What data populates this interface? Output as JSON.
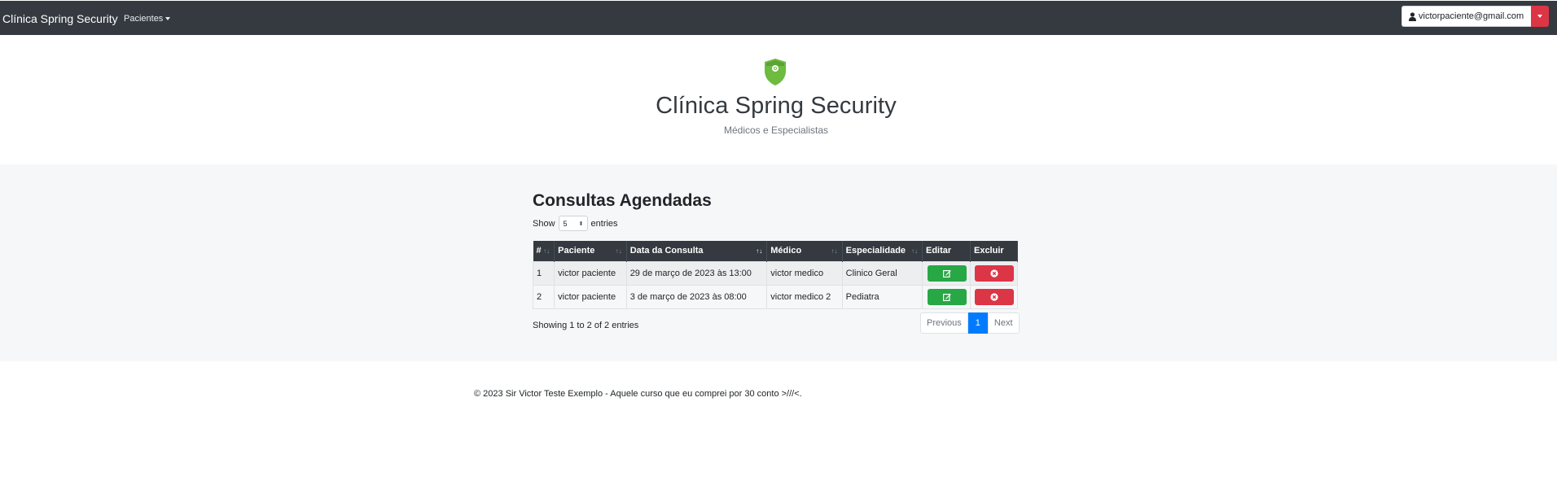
{
  "navbar": {
    "brand": "Clínica Spring Security",
    "menu_label": "Pacientes",
    "user_email": "victorpaciente@gmail.com"
  },
  "header": {
    "title": "Clínica Spring Security",
    "subtitle": "Médicos e Especialistas"
  },
  "main": {
    "section_title": "Consultas Agendadas",
    "show_label": "Show",
    "show_value": "5",
    "entries_label": "entries",
    "table": {
      "columns": [
        "#",
        "Paciente",
        "Data da Consulta",
        "Médico",
        "Especialidade",
        "Editar",
        "Excluir"
      ],
      "rows": [
        {
          "id": "1",
          "paciente": "victor paciente",
          "data": "29 de março de 2023 às 13:00",
          "medico": "victor medico",
          "especialidade": "Clinico Geral"
        },
        {
          "id": "2",
          "paciente": "victor paciente",
          "data": "3 de março de 2023 às 08:00",
          "medico": "victor medico 2",
          "especialidade": "Pediatra"
        }
      ]
    },
    "info": "Showing 1 to 2 of 2 entries",
    "pagination": {
      "previous": "Previous",
      "current": "1",
      "next": "Next"
    }
  },
  "footer": {
    "text": "© 2023 Sir Victor Teste Exemplo - Aquele curso que eu comprei por 30 conto >///<."
  },
  "colors": {
    "navbar": "#343a40",
    "accent_green": "#28a745",
    "accent_red": "#dc3545",
    "active_page": "#007bff",
    "shield": "#6dbb3f"
  },
  "icons": {
    "user": "user-icon",
    "shield": "shield-icon",
    "edit": "edit-icon",
    "delete": "times-circle-icon"
  }
}
